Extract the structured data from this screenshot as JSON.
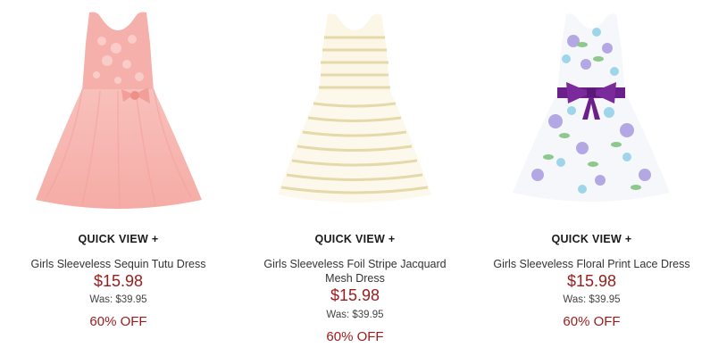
{
  "products": [
    {
      "quick_view": "QUICK VIEW +",
      "name": "Girls Sleeveless Sequin Tutu Dress",
      "price": "$15.98",
      "was": "Was: $39.95",
      "discount": "60% OFF",
      "colors": {
        "main": "#f7b4b0",
        "accent": "#ee9a96"
      }
    },
    {
      "quick_view": "QUICK VIEW +",
      "name": "Girls Sleeveless Foil Stripe Jacquard Mesh Dress",
      "price": "$15.98",
      "was": "Was: $39.95",
      "discount": "60% OFF",
      "colors": {
        "main": "#fbf7ea",
        "accent": "#e6d9a8"
      }
    },
    {
      "quick_view": "QUICK VIEW +",
      "name": "Girls Sleeveless Floral Print Lace Dress",
      "price": "$15.98",
      "was": "Was: $39.95",
      "discount": "60% OFF",
      "colors": {
        "main": "#f6f8fb",
        "accent": "#6a1f8a"
      }
    }
  ],
  "theme": {
    "price_color": "#9a1b1b",
    "text_color": "#333333"
  }
}
